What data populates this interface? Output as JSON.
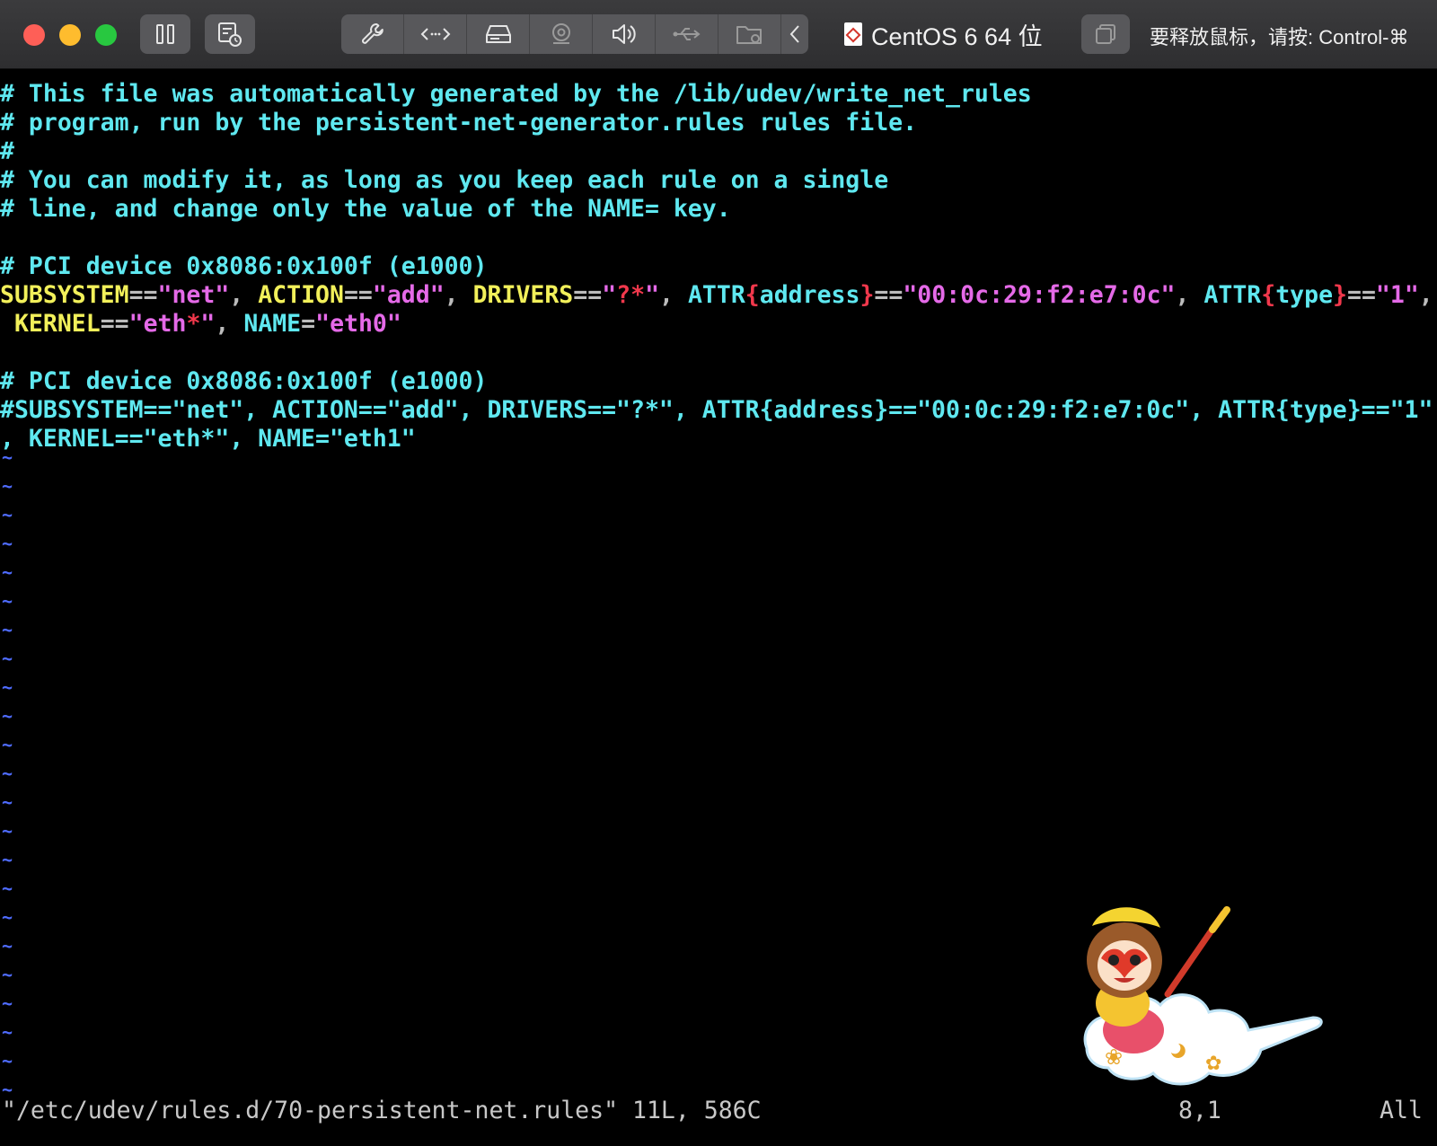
{
  "window": {
    "vm_title": "CentOS 6 64 位",
    "release_hint": "要释放鼠标，请按: Control-⌘"
  },
  "toolbar": {
    "buttons": [
      {
        "name": "suspend",
        "icon": "pause-icon"
      },
      {
        "name": "snapshot",
        "icon": "snapshot-icon"
      }
    ],
    "tools": [
      {
        "name": "settings",
        "icon": "wrench-icon"
      },
      {
        "name": "network",
        "icon": "network-arrows-icon"
      },
      {
        "name": "hard-disk",
        "icon": "hard-disk-icon"
      },
      {
        "name": "camera",
        "icon": "camera-icon"
      },
      {
        "name": "sound",
        "icon": "speaker-icon"
      },
      {
        "name": "usb",
        "icon": "usb-icon"
      },
      {
        "name": "shared-folder",
        "icon": "folder-icon"
      },
      {
        "name": "collapse",
        "icon": "chevron-left-icon"
      }
    ]
  },
  "editor": {
    "lines": [
      {
        "type": "comment",
        "text": "# This file was automatically generated by the /lib/udev/write_net_rules"
      },
      {
        "type": "comment",
        "text": "# program, run by the persistent-net-generator.rules rules file."
      },
      {
        "type": "comment",
        "text": "#"
      },
      {
        "type": "comment",
        "text": "# You can modify it, as long as you keep each rule on a single"
      },
      {
        "type": "comment",
        "text": "# line, and change only the value of the NAME= key."
      },
      {
        "type": "blank",
        "text": ""
      },
      {
        "type": "comment",
        "text": "# PCI device 0x8086:0x100f (e1000)"
      },
      {
        "type": "comment",
        "text": "# PCI device 0x8086:0x100f (e1000)"
      },
      {
        "type": "comment",
        "text": "#SUBSYSTEM==\"net\", ACTION==\"add\", DRIVERS==\"?*\", ATTR{address}==\"00:0c:29:f2:e7:0c\", ATTR{type}==\"1\""
      },
      {
        "type": "comment",
        "text": ", KERNEL==\"eth*\", NAME=\"eth1\""
      }
    ],
    "rule1": {
      "t1": "SUBSYSTEM",
      "t2": "==",
      "t3": "\"net\"",
      "t4": ", ",
      "t5": "ACTION",
      "t6": "==",
      "t7": "\"add\"",
      "t8": ", ",
      "t9": "DRIVERS",
      "t10": "==",
      "t11": "\"",
      "t12": "?*",
      "t13": "\"",
      "t14": ", ",
      "t15": "ATTR",
      "t16": "{",
      "t17": "address",
      "t18": "}",
      "t19": "==",
      "t20": "\"00:0c:29:f2:e7:0c\"",
      "t21": ", ",
      "t22": "ATTR",
      "t23": "{",
      "t24": "type",
      "t25": "}",
      "t26": "==",
      "t27": "\"1\"",
      "t28": ",",
      "u1": " ",
      "u2": "KERNEL",
      "u3": "==",
      "u4": "\"eth",
      "u5": "*",
      "u6": "\"",
      "u7": ", ",
      "u8": "NAME",
      "u9": "=",
      "u10": "\"eth0\""
    },
    "tilde": "~",
    "status_file": "\"/etc/udev/rules.d/70-persistent-net.rules\" 11L, 586C",
    "status_pos": "8,1",
    "status_scroll": "All"
  },
  "colors": {
    "comment": "#5fe8f0",
    "keyword": "#f2f05a",
    "string": "#e56ae8",
    "special": "#f2384c",
    "nontext": "#4f6cff"
  }
}
